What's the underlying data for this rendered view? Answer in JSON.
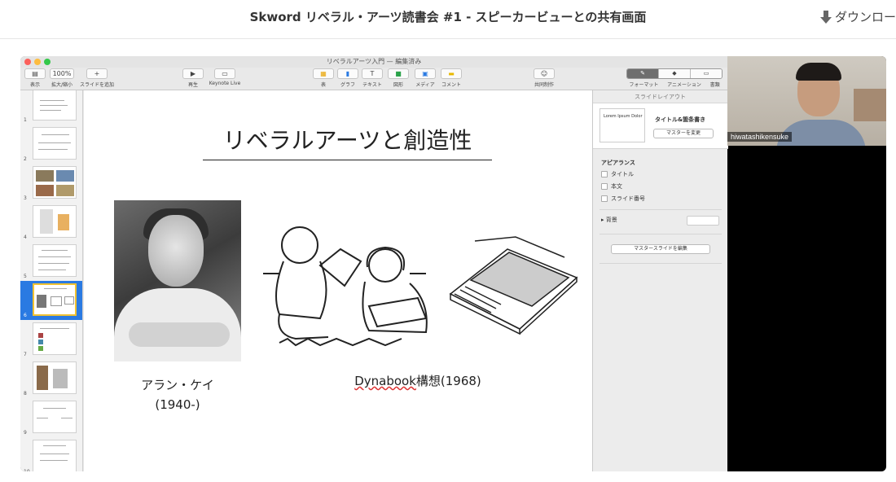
{
  "header": {
    "title": "Skword リベラル・アーツ読書会 #1 - スピーカービューとの共有画面",
    "download_label": "ダウンロー"
  },
  "keynote": {
    "window_title": "リベラルアーツ入門 — 編集済み",
    "toolbar": {
      "view_label": "表示",
      "zoom_value": "100%",
      "zoom_label": "拡大/縮小",
      "add_slide_label": "スライドを追加",
      "play_label": "再生",
      "keynote_live_label": "Keynote Live",
      "table_label": "表",
      "chart_label": "グラフ",
      "text_label": "テキスト",
      "shape_label": "図形",
      "media_label": "メディア",
      "comment_label": "コメント",
      "collab_label": "共同制作",
      "format_label": "フォーマット",
      "animate_label": "アニメーション",
      "document_label": "書類"
    },
    "navigator": {
      "slide_numbers": [
        "1",
        "2",
        "3",
        "4",
        "5",
        "6",
        "7",
        "8",
        "9",
        "10"
      ],
      "selected": "6"
    },
    "slide": {
      "title": "リベラルアーツと創造性",
      "caption_left_line1": "アラン・ケイ",
      "caption_left_line2": "(1940-)",
      "caption_right_underlined": "Dynabook",
      "caption_right_rest": "構想(1968)"
    },
    "inspector": {
      "header": "スライドレイアウト",
      "mini_slide_text": "Lorem Ipsum Dolor",
      "layout_name": "タイトル&箇条書き",
      "change_master": "マスターを変更",
      "appearance": "アピアランス",
      "options": [
        "タイトル",
        "本文",
        "スライド番号"
      ],
      "background": "背景",
      "edit_master": "マスタースライドを編集"
    }
  },
  "camera": {
    "participant_name": "hiwatashikensuke"
  },
  "colors": {
    "selection": "#2a7ae2",
    "traffic_red": "#fc605c",
    "traffic_yellow": "#fdbc40",
    "traffic_green": "#34c84a"
  }
}
